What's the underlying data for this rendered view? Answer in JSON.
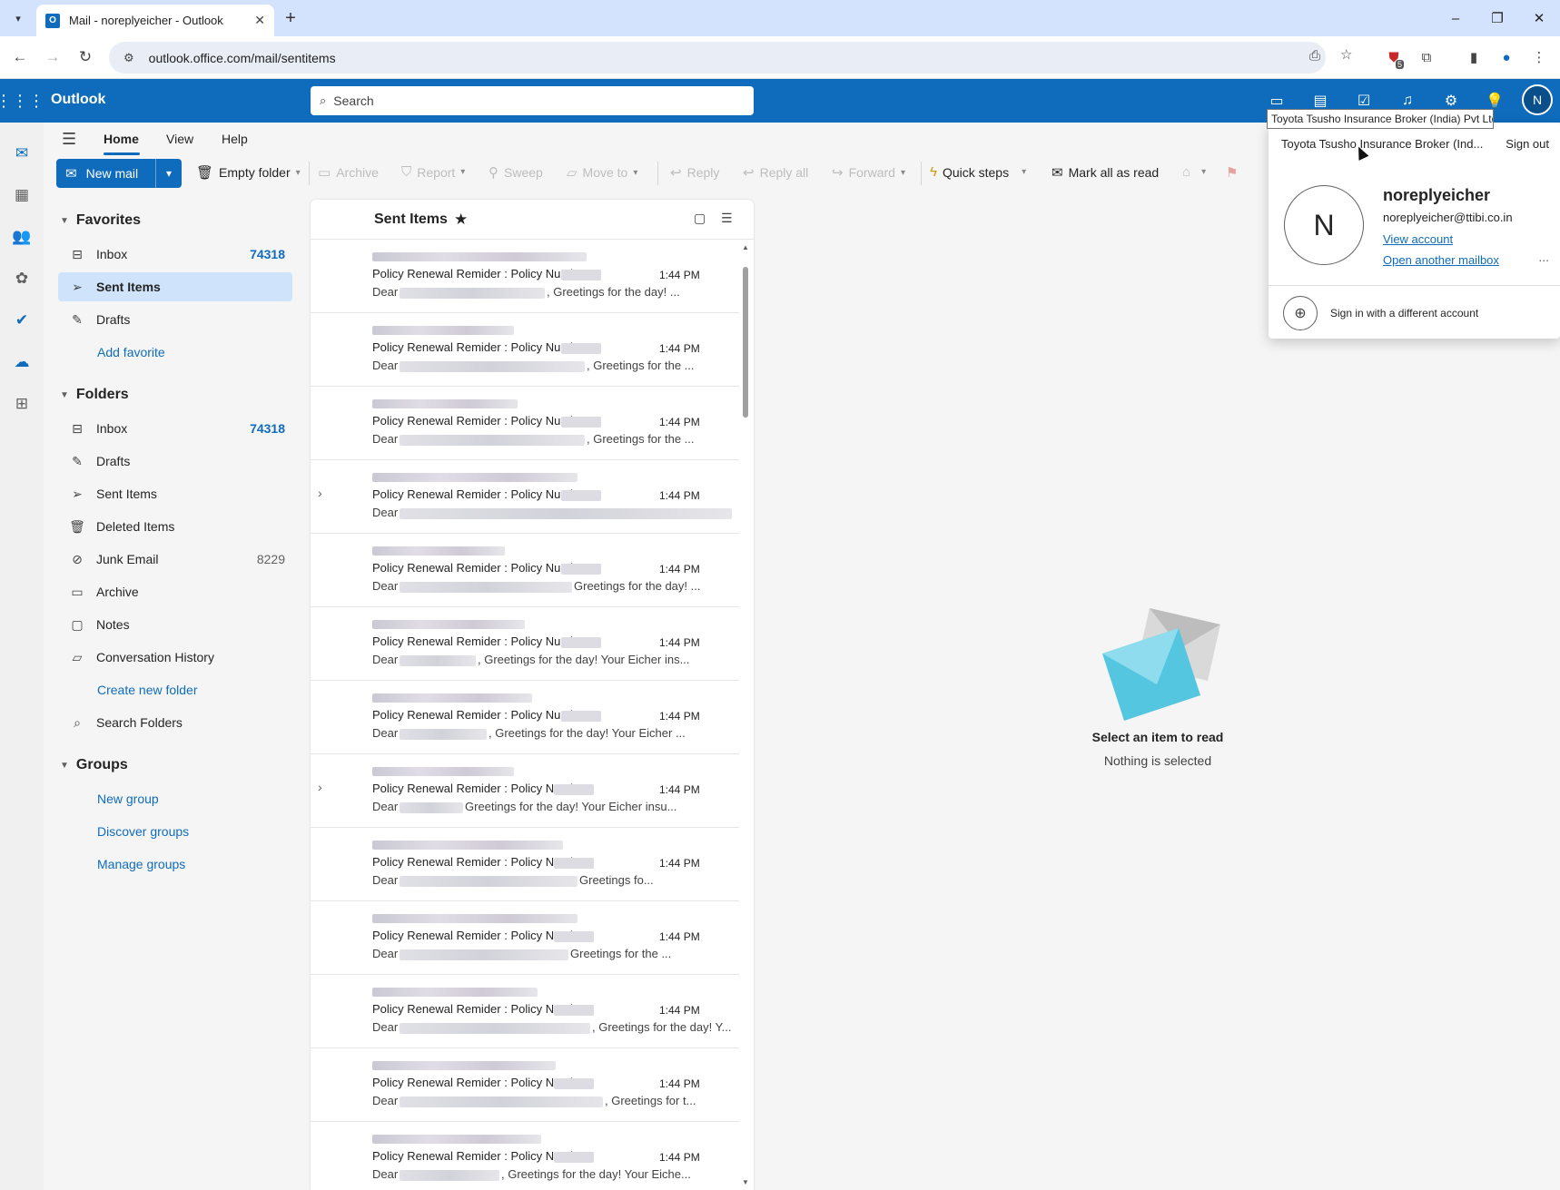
{
  "browser": {
    "tab_title": "Mail - noreplyeicher - Outlook",
    "url": "outlook.office.com/mail/sentitems",
    "extension_badge": "5"
  },
  "app": {
    "brand": "Outlook",
    "search_placeholder": "Search",
    "avatar_initial": "N"
  },
  "ribbon": {
    "tabs": [
      "Home",
      "View",
      "Help"
    ],
    "new_mail": "New mail",
    "empty_folder": "Empty folder",
    "archive": "Archive",
    "report": "Report",
    "sweep": "Sweep",
    "move_to": "Move to",
    "reply": "Reply",
    "reply_all": "Reply all",
    "forward": "Forward",
    "quick_steps": "Quick steps",
    "mark_all_read": "Mark all as read"
  },
  "folders": {
    "favorites_label": "Favorites",
    "favorites": [
      {
        "label": "Inbox",
        "count": "74318"
      },
      {
        "label": "Sent Items",
        "count": ""
      },
      {
        "label": "Drafts",
        "count": ""
      }
    ],
    "add_favorite": "Add favorite",
    "folders_label": "Folders",
    "items": [
      {
        "label": "Inbox",
        "count": "74318"
      },
      {
        "label": "Drafts",
        "count": ""
      },
      {
        "label": "Sent Items",
        "count": ""
      },
      {
        "label": "Deleted Items",
        "count": ""
      },
      {
        "label": "Junk Email",
        "count": "8229"
      },
      {
        "label": "Archive",
        "count": ""
      },
      {
        "label": "Notes",
        "count": ""
      },
      {
        "label": "Conversation History",
        "count": ""
      }
    ],
    "create_new_folder": "Create new folder",
    "search_folders": "Search Folders",
    "groups_label": "Groups",
    "new_group": "New group",
    "discover_groups": "Discover groups",
    "manage_groups": "Manage groups"
  },
  "message_list": {
    "title": "Sent Items",
    "messages": [
      {
        "subject": "Policy Renewal Remider : Policy Number :",
        "time": "1:44 PM",
        "dear": "Dear",
        "preview": ", Greetings for the day! ..."
      },
      {
        "subject": "Policy Renewal Remider : Policy Number :",
        "time": "1:44 PM",
        "dear": "Dear",
        "preview": ", Greetings for the ..."
      },
      {
        "subject": "Policy Renewal Remider : Policy Number :",
        "time": "1:44 PM",
        "dear": "Dear",
        "preview": ", Greetings for the ..."
      },
      {
        "subject": "Policy Renewal Remider : Policy Number :",
        "time": "1:44 PM",
        "dear": "Dear",
        "preview": ""
      },
      {
        "subject": "Policy Renewal Remider : Policy Number :",
        "time": "1:44 PM",
        "dear": "Dear",
        "preview": "Greetings for the day! ..."
      },
      {
        "subject": "Policy Renewal Remider : Policy Number :",
        "time": "1:44 PM",
        "dear": "Dear",
        "preview": ", Greetings for the day! Your Eicher ins..."
      },
      {
        "subject": "Policy Renewal Remider : Policy Number :",
        "time": "1:44 PM",
        "dear": "Dear",
        "preview": ", Greetings for the day! Your Eicher ..."
      },
      {
        "subject": "Policy Renewal Remider : Policy Number",
        "time": "1:44 PM",
        "dear": "Dear",
        "preview": "Greetings for the day! Your Eicher insu..."
      },
      {
        "subject": "Policy Renewal Remider : Policy Number",
        "time": "1:44 PM",
        "dear": "Dear",
        "preview": "Greetings fo..."
      },
      {
        "subject": "Policy Renewal Remider : Policy Number",
        "time": "1:44 PM",
        "dear": "Dear",
        "preview": "Greetings for the ..."
      },
      {
        "subject": "Policy Renewal Remider : Policy Number",
        "time": "1:44 PM",
        "dear": "Dear",
        "preview": ", Greetings for the day! Y..."
      },
      {
        "subject": "Policy Renewal Remider : Policy Number",
        "time": "1:44 PM",
        "dear": "Dear",
        "preview": ", Greetings for t..."
      },
      {
        "subject": "Policy Renewal Remider : Policy Number",
        "time": "1:44 PM",
        "dear": "Dear",
        "preview": ", Greetings for the day! Your Eiche..."
      }
    ]
  },
  "reading_pane": {
    "title": "Select an item to read",
    "subtitle": "Nothing is selected"
  },
  "account_card": {
    "tooltip": "Toyota Tsusho Insurance Broker (India) Pvt Ltd",
    "org": "Toyota Tsusho Insurance Broker (Ind...",
    "sign_out": "Sign out",
    "initial": "N",
    "name": "noreplyeicher",
    "email": "noreplyeicher@ttibi.co.in",
    "view_account": "View account",
    "open_another": "Open another mailbox",
    "more": "...",
    "sign_in_different": "Sign in with a different account"
  }
}
